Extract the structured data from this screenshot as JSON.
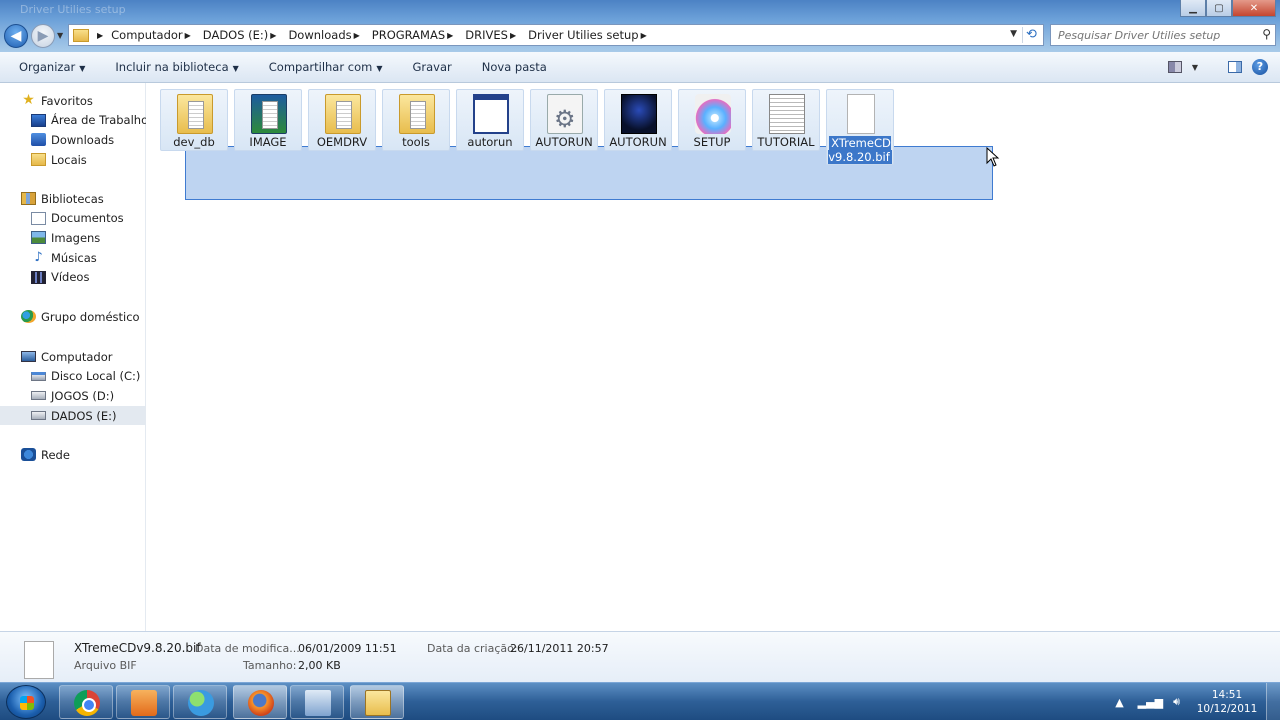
{
  "window": {
    "title": "Driver Utilies setup"
  },
  "address": {
    "crumbs": [
      "Computador",
      "DADOS (E:)",
      "Downloads",
      "PROGRAMAS",
      "DRIVES",
      "Driver Utilies setup"
    ],
    "search_placeholder": "Pesquisar Driver Utilies setup"
  },
  "toolbar": {
    "organize": "Organizar",
    "include_library": "Incluir na biblioteca",
    "share": "Compartilhar com",
    "burn": "Gravar",
    "new_folder": "Nova pasta"
  },
  "sidebar": {
    "favorites": {
      "label": "Favoritos",
      "items": [
        "Área de Trabalho",
        "Downloads",
        "Locais"
      ]
    },
    "libraries": {
      "label": "Bibliotecas",
      "items": [
        "Documentos",
        "Imagens",
        "Músicas",
        "Vídeos"
      ]
    },
    "homegroup": {
      "label": "Grupo doméstico"
    },
    "computer": {
      "label": "Computador",
      "items": [
        "Disco Local (C:)",
        "JOGOS (D:)",
        "DADOS (E:)"
      ],
      "selected": "DADOS (E:)"
    },
    "network": {
      "label": "Rede"
    }
  },
  "files": [
    {
      "name": "dev_db",
      "icon": "folder-icon"
    },
    {
      "name": "IMAGE",
      "icon": "image-folder-icon"
    },
    {
      "name": "OEMDRV",
      "icon": "folder-icon"
    },
    {
      "name": "tools",
      "icon": "folder-icon"
    },
    {
      "name": "autorun",
      "icon": "window-icon"
    },
    {
      "name": "AUTORUN",
      "icon": "settings-file-icon"
    },
    {
      "name": "AUTORUN",
      "icon": "app-icon"
    },
    {
      "name": "SETUP",
      "icon": "setup-disc-icon"
    },
    {
      "name": "TUTORIAL",
      "icon": "document-icon"
    },
    {
      "name": "XTremeCD v9.8.20.bif",
      "icon": "blank-file-icon",
      "selected": true
    }
  ],
  "details": {
    "filename": "XTremeCDv9.8.20.bif",
    "type": "Arquivo BIF",
    "modified_label": "Data de modifica...",
    "modified_value": "06/01/2009 11:51",
    "size_label": "Tamanho:",
    "size_value": "2,00 KB",
    "created_label": "Data da criação:",
    "created_value": "26/11/2011 20:57"
  },
  "taskbar": {
    "time": "14:51",
    "date": "10/12/2011",
    "apps": [
      "chrome",
      "media-player",
      "messenger",
      "firefox",
      "window",
      "windows-explorer"
    ]
  }
}
